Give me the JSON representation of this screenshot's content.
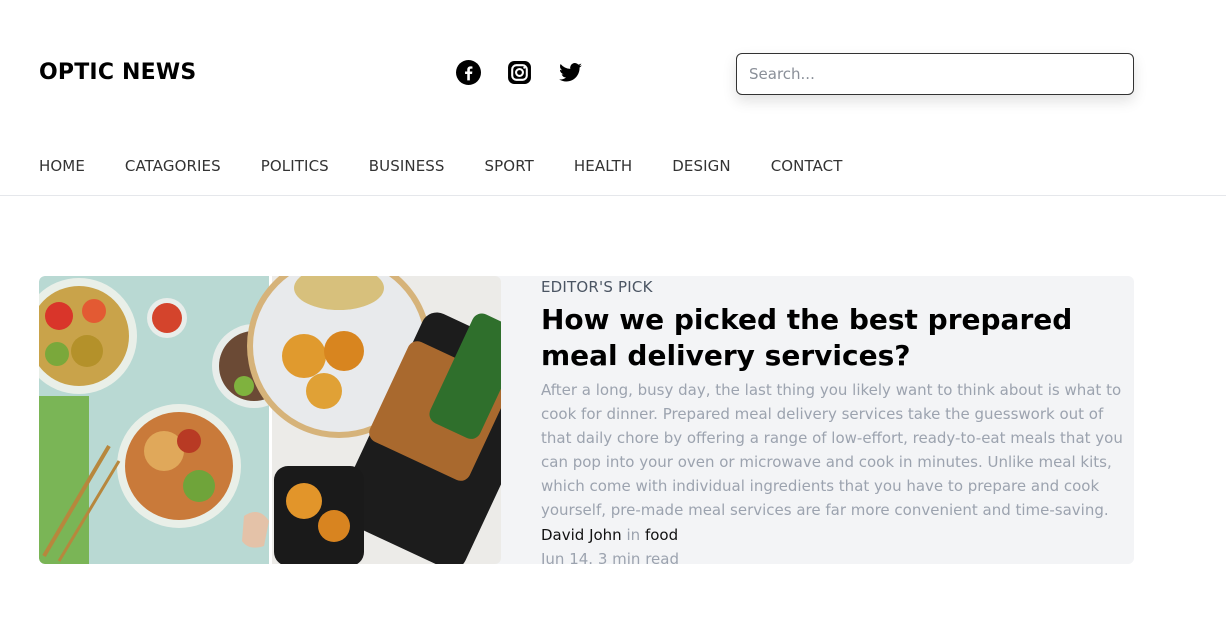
{
  "site": {
    "logo": "OPTIC NEWS"
  },
  "social": [
    {
      "icon": "facebook-icon"
    },
    {
      "icon": "instagram-icon"
    },
    {
      "icon": "twitter-icon"
    }
  ],
  "search": {
    "placeholder": "Search...",
    "value": ""
  },
  "nav": {
    "items": [
      "HOME",
      "CATAGORIES",
      "POLITICS",
      "BUSINESS",
      "SPORT",
      "HEALTH",
      "DESIGN",
      "CONTACT"
    ]
  },
  "featured": {
    "kicker": "EDITOR'S PICK",
    "title": "How we picked the best prepared meal delivery services?",
    "excerpt": "After a long, busy day, the last thing you likely want to think about is what to cook for dinner. Prepared meal delivery services take the guesswork out of that daily chore by offering a range of low-effort, ready-to-eat meals that you can pop into your oven or microwave and cook in minutes. Unlike meal kits, which come with individual ingredients that you have to prepare and cook yourself, pre-made meal services are far more convenient and time-saving.",
    "author": "David John",
    "in_word": "in",
    "category": "food",
    "date_meta": "Jun 14. 3 min read",
    "image_icon": "meal-photo"
  },
  "colors": {
    "card_bg": "#f3f4f6",
    "muted_text": "#9ca3af",
    "border": "#e5e7eb"
  }
}
